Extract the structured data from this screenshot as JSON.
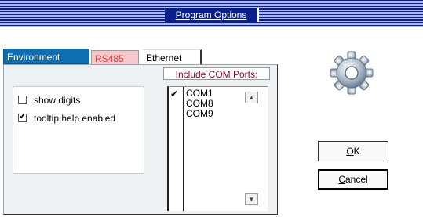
{
  "window": {
    "title": "Program Options"
  },
  "tabs": [
    {
      "label": "Environment",
      "active": true
    },
    {
      "label": "RS485",
      "active": false
    },
    {
      "label": "Ethernet",
      "active": false
    }
  ],
  "options": [
    {
      "label": "show digits",
      "checked": false
    },
    {
      "label": "tooltip help enabled",
      "checked": true
    }
  ],
  "com_ports": {
    "label": "Include COM Ports:",
    "check_mark": "✔",
    "items": [
      "COM1",
      "COM8",
      "COM9"
    ]
  },
  "buttons": {
    "ok": {
      "mnemonic": "O",
      "rest": "K"
    },
    "cancel": {
      "mnemonic": "C",
      "rest": "ancel"
    }
  },
  "icons": {
    "settings": "gear-icon",
    "scroll_up": "triangle-up-icon",
    "scroll_down": "triangle-down-icon"
  },
  "colors": {
    "title_bar": "#0a1f87",
    "tab_active": "#0f6fb2",
    "tab_rs485_text": "#e13a3a",
    "com_label": "#8a0a2a"
  }
}
